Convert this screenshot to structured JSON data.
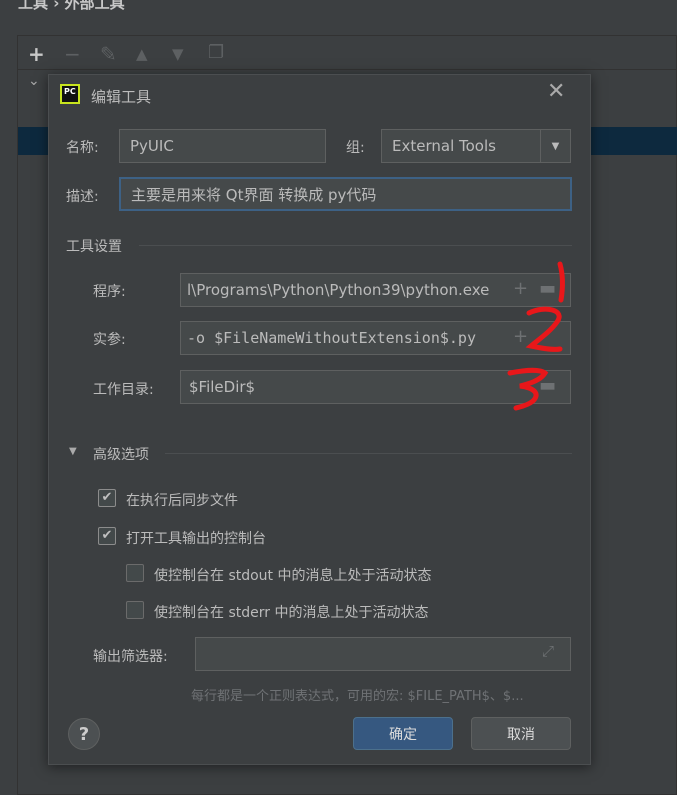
{
  "breadcrumb": {
    "parent": "工具",
    "separator": "›",
    "current": "外部工具"
  },
  "toolbar": {
    "add": "+",
    "remove": "−",
    "edit": "✎",
    "up": "▲",
    "down": "▼",
    "copy": "❐"
  },
  "dialog": {
    "title": "编辑工具",
    "logo_text": "PC",
    "name_label": "名称:",
    "name_value": "PyUIC",
    "group_label": "组:",
    "group_value": "External Tools",
    "desc_label": "描述:",
    "desc_value": "主要是用来将 Qt界面 转换成 py代码",
    "tool_settings": "工具设置",
    "program_label": "程序:",
    "program_value": "l\\Programs\\Python\\Python39\\python.exe",
    "args_label": "实参:",
    "args_value": "-o $FileNameWithoutExtension$.py",
    "workdir_label": "工作目录:",
    "workdir_value": "$FileDir$",
    "advanced": "高级选项",
    "checkboxes": [
      {
        "label": "在执行后同步文件",
        "checked": true
      },
      {
        "label": "打开工具输出的控制台",
        "checked": true
      },
      {
        "label": "使控制台在 stdout 中的消息上处于活动状态",
        "checked": false
      },
      {
        "label": "使控制台在 stderr 中的消息上处于活动状态",
        "checked": false
      }
    ],
    "filter_label": "输出筛选器:",
    "filter_value": "",
    "hint": "每行都是一个正则表达式，可用的宏: $FILE_PATH$、$...",
    "help": "?",
    "ok": "确定",
    "cancel": "取消",
    "accent_color": "#365880"
  },
  "annotations": [
    "1",
    "2",
    "3"
  ],
  "annotation_color": "#e8171a"
}
